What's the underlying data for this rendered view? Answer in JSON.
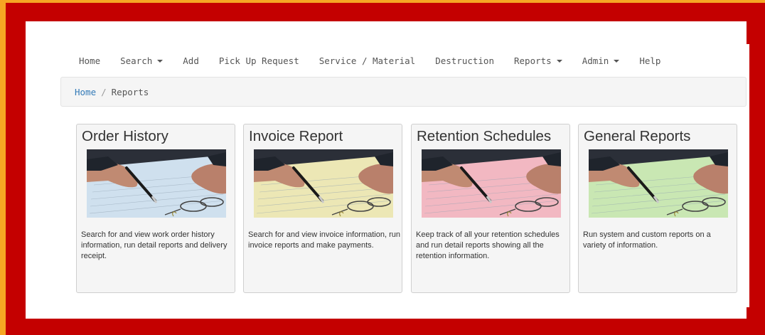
{
  "nav": {
    "items": [
      {
        "label": "Home",
        "dropdown": false
      },
      {
        "label": "Search",
        "dropdown": true
      },
      {
        "label": "Add",
        "dropdown": false
      },
      {
        "label": "Pick Up Request",
        "dropdown": false
      },
      {
        "label": "Service / Material",
        "dropdown": false
      },
      {
        "label": "Destruction",
        "dropdown": false
      },
      {
        "label": "Reports",
        "dropdown": true
      },
      {
        "label": "Admin",
        "dropdown": true
      },
      {
        "label": "Help",
        "dropdown": false
      }
    ]
  },
  "breadcrumb": {
    "home": "Home",
    "separator": "/",
    "current": "Reports"
  },
  "cards": [
    {
      "title": "Order History",
      "description": "Search for and view work order history information, run detail reports and delivery receipt.",
      "paper_color": "#cfe0ee"
    },
    {
      "title": "Invoice Report",
      "description": "Search for and view invoice information, run invoice reports and make payments.",
      "paper_color": "#ece7b5"
    },
    {
      "title": "Retention Schedules",
      "description": "Keep track of all your retention schedules and run detail reports showing all the retention information.",
      "paper_color": "#f2b8c2"
    },
    {
      "title": "General Reports",
      "description": "Run system and custom reports on a variety of information.",
      "paper_color": "#c9e7b3"
    }
  ],
  "colors": {
    "frame": "#c40000",
    "outer": "#f6a623",
    "link": "#337ab7"
  }
}
